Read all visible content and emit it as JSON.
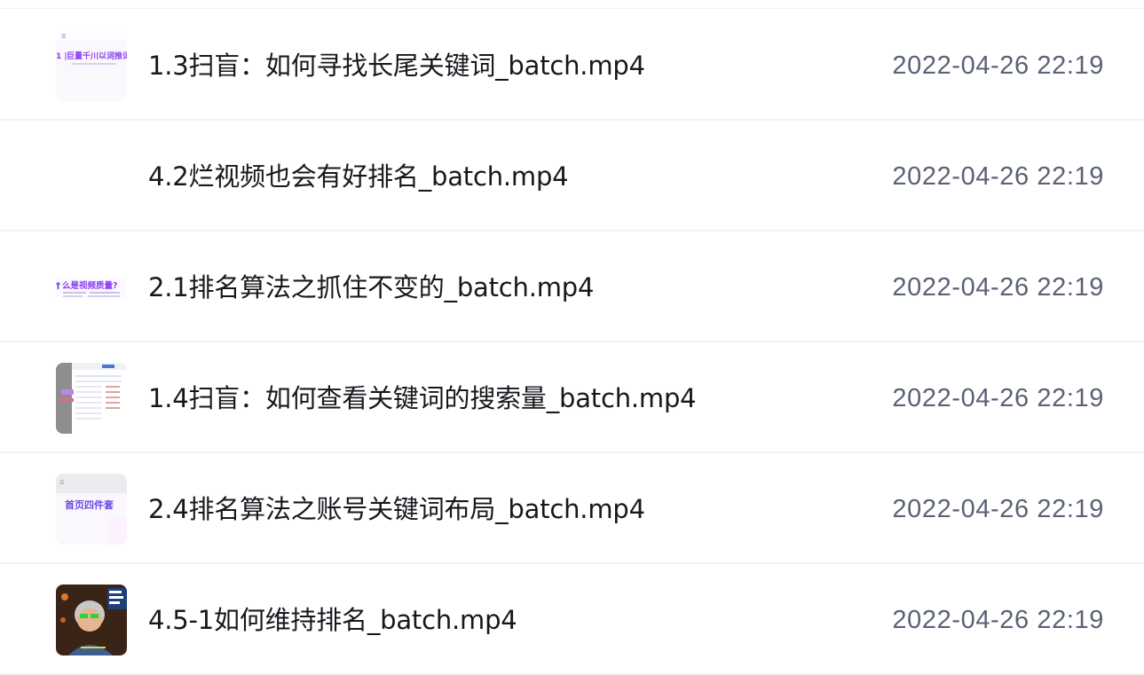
{
  "files": [
    {
      "name": "1.3扫盲：如何寻找长尾关键词_batch.mp4",
      "date": "2022-04-26 22:19",
      "thumb_text": "巨量千川以词推词",
      "thumb_icon": "video-thumbnail-icon"
    },
    {
      "name": "4.2烂视频也会有好排名_batch.mp4",
      "date": "2022-04-26 22:19",
      "thumb_icon": "blank-thumbnail-icon"
    },
    {
      "name": "2.1排名算法之抓住不变的_batch.mp4",
      "date": "2022-04-26 22:19",
      "thumb_text": "么是视频质量?",
      "thumb_icon": "video-thumbnail-icon"
    },
    {
      "name": "1.4扫盲：如何查看关键词的搜索量_batch.mp4",
      "date": "2022-04-26 22:19",
      "thumb_icon": "screenshot-thumbnail-icon"
    },
    {
      "name": "2.4排名算法之账号关键词布局_batch.mp4",
      "date": "2022-04-26 22:19",
      "thumb_text": "首页四件套",
      "thumb_icon": "video-thumbnail-icon"
    },
    {
      "name": "4.5-1如何维持排名_batch.mp4",
      "date": "2022-04-26 22:19",
      "thumb_icon": "person-thumbnail-icon"
    }
  ],
  "colors": {
    "name_text": "#16181d",
    "date_text": "#5a6275",
    "divider": "#f1f2f4",
    "accent_purple": "#8a3ff0"
  }
}
